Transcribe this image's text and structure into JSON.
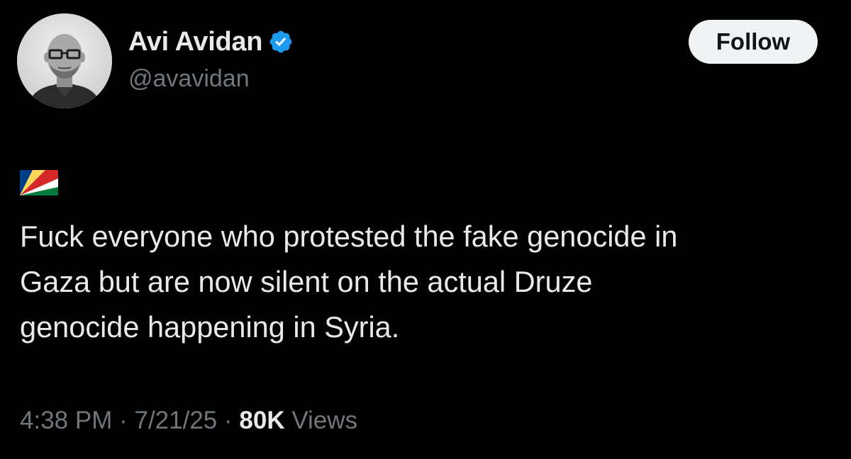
{
  "author": {
    "display_name": "Avi Avidan",
    "handle": "@avavidan",
    "verified_icon": "verified-badge-icon",
    "verified_color": "#1d9bf0"
  },
  "follow_button": {
    "label": "Follow"
  },
  "tweet": {
    "flag_emoji": "seychelles-flag-icon",
    "text_lines": [
      "Fuck everyone who protested the fake genocide in",
      "Gaza but are now silent on the actual Druze",
      "genocide happening in Syria."
    ]
  },
  "meta": {
    "time": "4:38 PM",
    "separator": "·",
    "date": "7/21/25",
    "views_count": "80K",
    "views_label": "Views"
  },
  "colors": {
    "background": "#000000",
    "primary_text": "#e7e9ea",
    "secondary_text": "#71767b",
    "button_bg": "#eff3f4"
  }
}
